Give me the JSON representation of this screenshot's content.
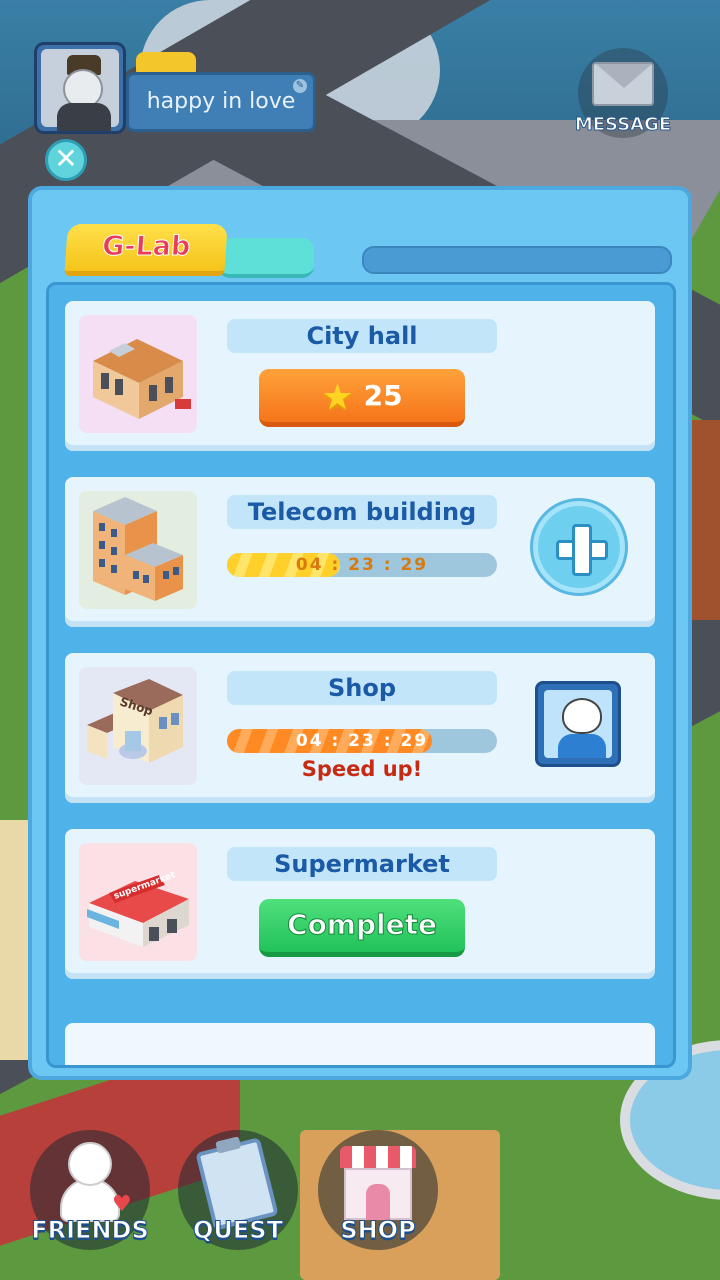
{
  "profile": {
    "name": "happy in love"
  },
  "top": {
    "message_label": "MESSAGE",
    "close_symbol": "✕"
  },
  "panel": {
    "tabs": [
      {
        "label": "G-Lab",
        "active": true
      },
      {
        "label": "",
        "active": false
      }
    ],
    "buildings": [
      {
        "name": "City hall",
        "action": {
          "type": "cost",
          "icon": "star-icon",
          "value": "25"
        }
      },
      {
        "name": "Telecom building",
        "timer": "04 : 23 : 29",
        "progress": 0.42,
        "side_action": "plus-icon"
      },
      {
        "name": "Shop",
        "timer": "04 : 23 : 29",
        "progress": 0.76,
        "speed_up": "Speed up!",
        "side_action": "friend-helper"
      },
      {
        "name": "Supermarket",
        "action": {
          "type": "complete",
          "label": "Complete"
        }
      }
    ],
    "thumb_labels": {
      "shop_sign": "Shop",
      "market_sign": "supermarket"
    }
  },
  "nav": {
    "items": [
      {
        "label": "FRIENDS",
        "icon": "friends-icon"
      },
      {
        "label": "QUEST",
        "icon": "clipboard-icon"
      },
      {
        "label": "SHOP",
        "icon": "store-icon"
      }
    ]
  },
  "colors": {
    "panel_bg": "#6cc7f3",
    "card_bg": "#eef8fe",
    "title_text": "#1a5aa6",
    "star_button": "#f5751a",
    "complete_button": "#22c25a",
    "speed_up_text": "#c72a12"
  }
}
